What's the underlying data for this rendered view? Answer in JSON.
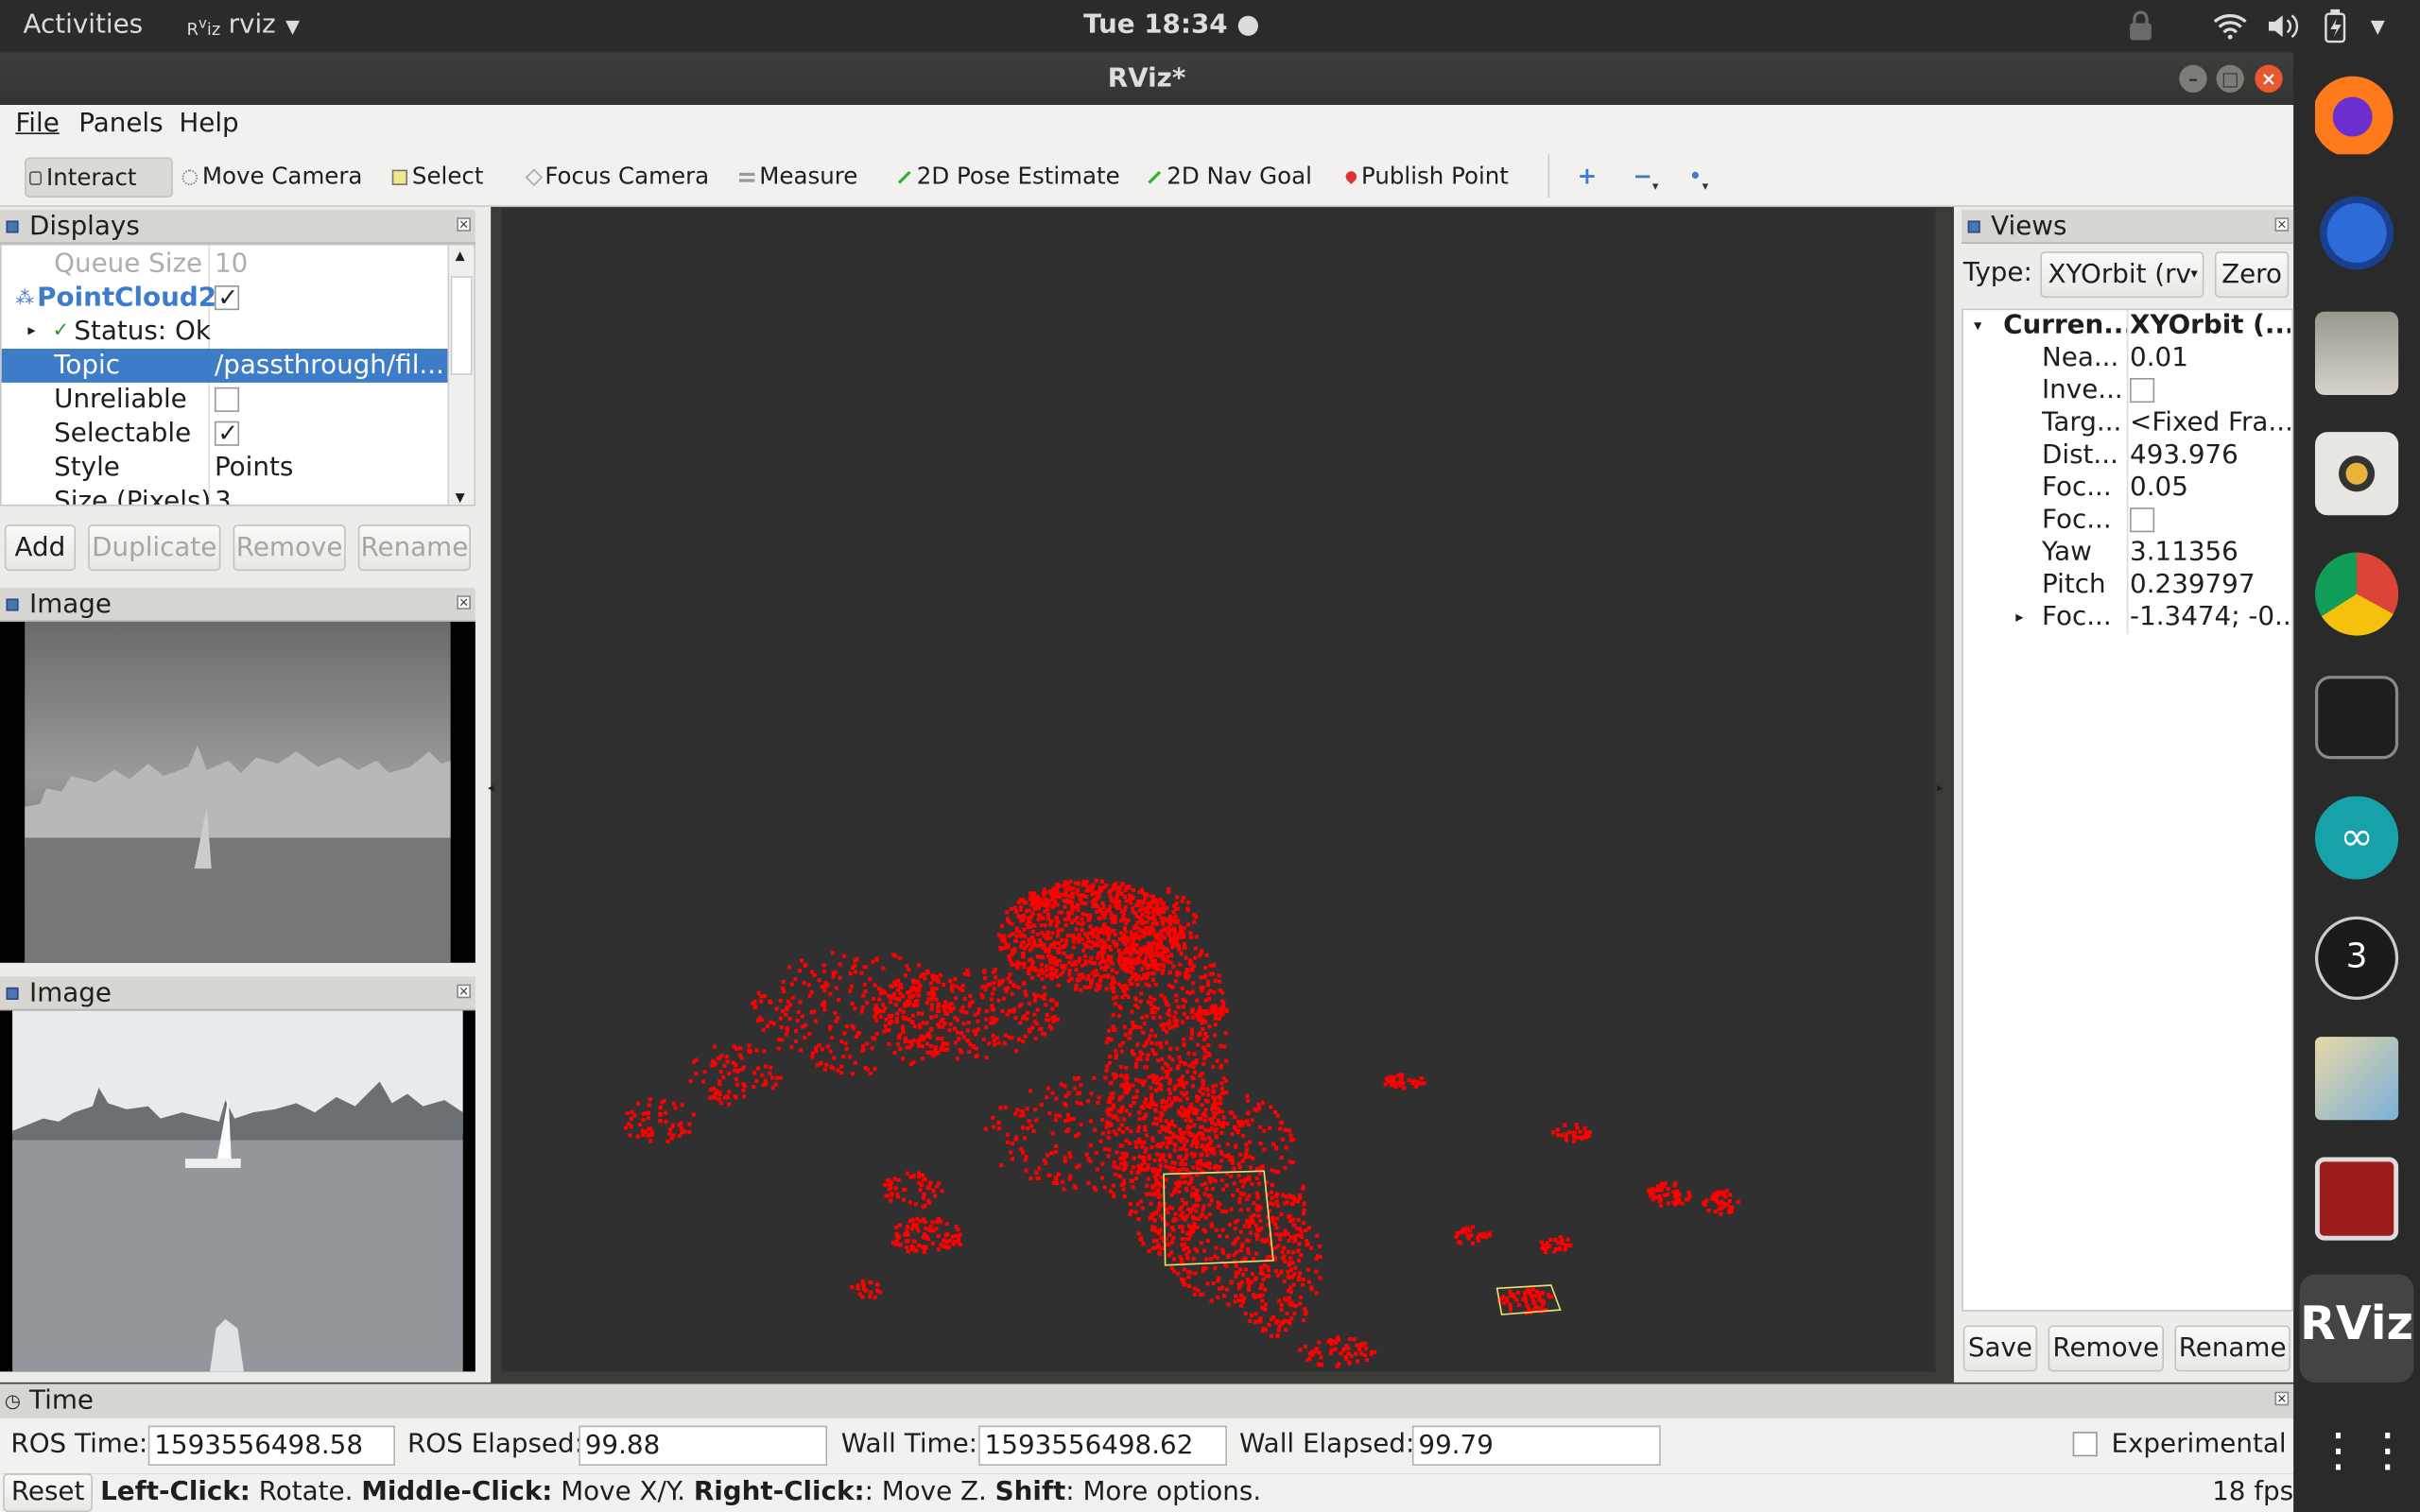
{
  "topbar": {
    "activities": "Activities",
    "app_name": "rviz",
    "clock": "Tue 18:34 ●"
  },
  "window": {
    "title": "RViz*"
  },
  "menu": [
    "File",
    "Panels",
    "Help"
  ],
  "toolbar": {
    "interact": "Interact",
    "move_camera": "Move Camera",
    "select": "Select",
    "focus_camera": "Focus Camera",
    "measure": "Measure",
    "pose_estimate": "2D Pose Estimate",
    "nav_goal": "2D Nav Goal",
    "publish_point": "Publish Point"
  },
  "displays": {
    "title": "Displays",
    "rows": [
      {
        "key": "Queue Size",
        "value": "10"
      },
      {
        "key": "PointCloud2",
        "checked": true
      },
      {
        "key": "Status: Ok"
      },
      {
        "key": "Topic",
        "value": "/passthrough/fil..."
      },
      {
        "key": "Unreliable",
        "checked": false
      },
      {
        "key": "Selectable",
        "checked": true
      },
      {
        "key": "Style",
        "value": "Points"
      },
      {
        "key": "Size (Pixels)",
        "value": "3"
      }
    ],
    "buttons": {
      "add": "Add",
      "duplicate": "Duplicate",
      "remove": "Remove",
      "rename": "Rename"
    }
  },
  "image_panels": [
    {
      "title": "Image"
    },
    {
      "title": "Image"
    }
  ],
  "views": {
    "title": "Views",
    "type_label": "Type:",
    "type_value": "XYOrbit (rv",
    "zero": "Zero",
    "header_key": "Curren...",
    "header_value": "XYOrbit (...",
    "rows": [
      {
        "key": "Nea...",
        "value": "0.01"
      },
      {
        "key": "Inve...",
        "checkbox": true
      },
      {
        "key": "Targ...",
        "value": "<Fixed Fra..."
      },
      {
        "key": "Dist...",
        "value": "493.976"
      },
      {
        "key": "Foc...",
        "value": "0.05"
      },
      {
        "key": "Foc...",
        "checkbox": true
      },
      {
        "key": "Yaw",
        "value": "3.11356"
      },
      {
        "key": "Pitch",
        "value": "0.239797"
      },
      {
        "key": "Foc...",
        "value": "-1.3474; -0..."
      }
    ],
    "buttons": {
      "save": "Save",
      "remove": "Remove",
      "rename": "Rename"
    }
  },
  "time": {
    "title": "Time",
    "ros_time_label": "ROS Time:",
    "ros_time": "1593556498.58",
    "ros_elapsed_label": "ROS Elapsed:",
    "ros_elapsed": "99.88",
    "wall_time_label": "Wall Time:",
    "wall_time": "1593556498.62",
    "wall_elapsed_label": "Wall Elapsed:",
    "wall_elapsed": "99.79",
    "experimental": "Experimental"
  },
  "status": {
    "reset": "Reset",
    "left_click": "Left-Click:",
    "left_action": "Rotate.",
    "middle_click": "Middle-Click:",
    "middle_action": "Move X/Y.",
    "right_click": "Right-Click:",
    "right_action": ": Move Z.",
    "shift": "Shift",
    "shift_action": ": More options.",
    "fps": "18 fps"
  },
  "dock_apps": [
    "firefox-icon",
    "thunderbird-icon",
    "files-icon",
    "rhythmbox-icon",
    "chrome-icon",
    "system-monitor-icon",
    "arduino-icon",
    "blender-icon",
    "maps-icon",
    "terminal-icon",
    "rviz-icon",
    "app-grid-icon"
  ],
  "colors": {
    "point_cloud": "#ff0000",
    "viewport_bg": "#303030",
    "selection_blue": "#3d7cc9"
  }
}
